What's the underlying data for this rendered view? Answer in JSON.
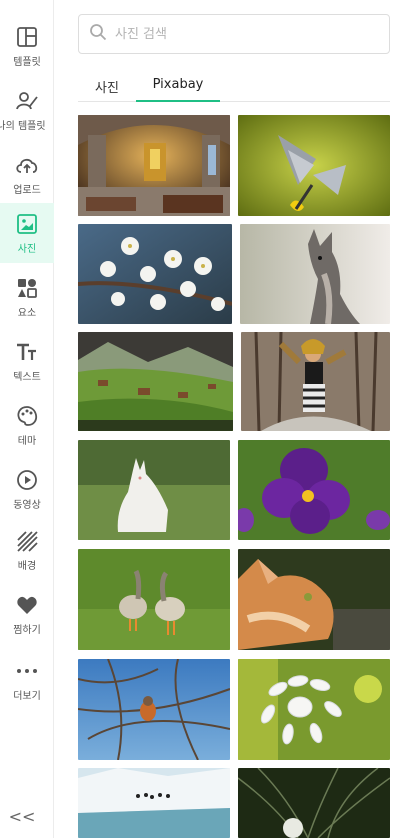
{
  "sidebar": {
    "items": [
      {
        "label": "템플릿",
        "icon": "layout-icon"
      },
      {
        "label": "나의 템플릿",
        "icon": "my-template-icon"
      },
      {
        "label": "업로드",
        "icon": "upload-cloud-icon"
      },
      {
        "label": "사진",
        "icon": "image-icon",
        "active": true
      },
      {
        "label": "요소",
        "icon": "shapes-icon"
      },
      {
        "label": "텍스트",
        "icon": "text-icon"
      },
      {
        "label": "테마",
        "icon": "palette-icon"
      },
      {
        "label": "동영상",
        "icon": "play-circle-icon"
      },
      {
        "label": "배경",
        "icon": "hatch-pattern-icon"
      },
      {
        "label": "찜하기",
        "icon": "heart-icon"
      },
      {
        "label": "더보기",
        "icon": "more-dots-icon"
      }
    ],
    "collapse_glyph": "<<",
    "accent_color": "#1fbf85"
  },
  "search": {
    "placeholder": "사진 검색",
    "value": ""
  },
  "tabs": [
    {
      "label": "사진",
      "active": false
    },
    {
      "label": "Pixabay",
      "active": true
    }
  ],
  "gallery": {
    "source": "Pixabay",
    "thumbnails": [
      {
        "subject": "church-interior"
      },
      {
        "subject": "butterfly-on-flower"
      },
      {
        "subject": "white-blossoms"
      },
      {
        "subject": "wallaby"
      },
      {
        "subject": "mountain-village"
      },
      {
        "subject": "woman-in-forest"
      },
      {
        "subject": "white-wallaby"
      },
      {
        "subject": "purple-pansy"
      },
      {
        "subject": "two-geese"
      },
      {
        "subject": "ginger-cat"
      },
      {
        "subject": "bird-in-branches"
      },
      {
        "subject": "white-agapanthus"
      },
      {
        "subject": "penguins-on-ice"
      },
      {
        "subject": "white-peacock"
      }
    ]
  }
}
